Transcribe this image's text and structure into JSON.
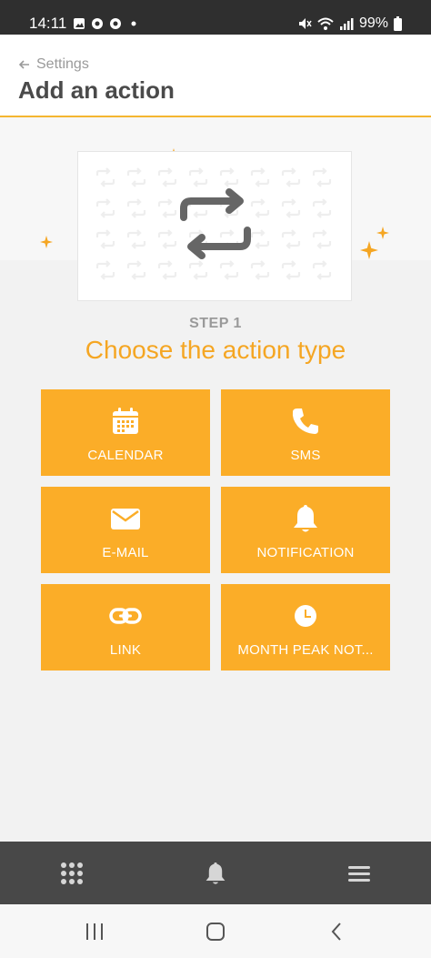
{
  "status_bar": {
    "time": "14:11",
    "battery": "99%",
    "left_icons": [
      "image-icon",
      "chrome-icon",
      "chrome-icon",
      "dot-icon"
    ],
    "right_icons": [
      "mute-icon",
      "wifi-icon",
      "signal-icon",
      "battery-icon"
    ]
  },
  "header": {
    "back_label": "Settings",
    "title": "Add an action"
  },
  "step": {
    "label": "STEP 1",
    "title": "Choose the action type"
  },
  "actions": [
    {
      "label": "CALENDAR",
      "icon": "calendar-icon"
    },
    {
      "label": "SMS",
      "icon": "phone-icon"
    },
    {
      "label": "E-MAIL",
      "icon": "envelope-icon"
    },
    {
      "label": "NOTIFICATION",
      "icon": "bell-icon"
    },
    {
      "label": "LINK",
      "icon": "link-icon"
    },
    {
      "label": "MONTH PEAK NOT...",
      "icon": "clock-icon"
    }
  ],
  "bottom_nav": [
    "grid-icon",
    "bell-icon",
    "menu-icon"
  ],
  "system_nav": [
    "recents-icon",
    "home-icon",
    "back-icon"
  ],
  "colors": {
    "accent": "#fbad28",
    "title_accent": "#f5a623",
    "status_bar": "#2f2f2f",
    "bottom_nav": "#484848"
  }
}
